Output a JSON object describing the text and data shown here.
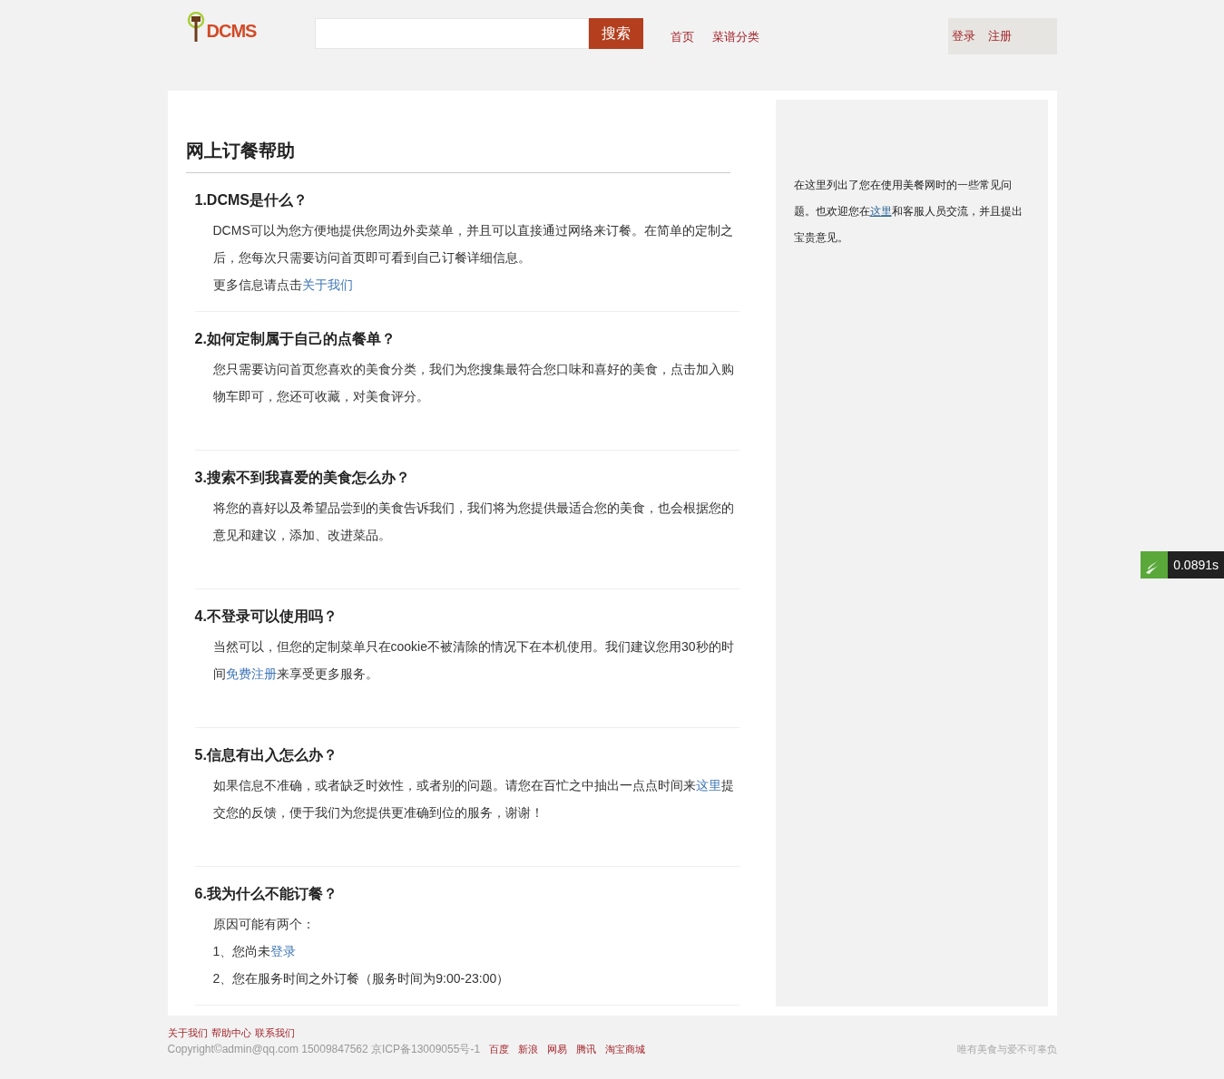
{
  "header": {
    "logo": "DCMS",
    "search": {
      "button": "搜索"
    },
    "nav": [
      "首页",
      "菜谱分类"
    ],
    "account": [
      "登录",
      "注册"
    ]
  },
  "page_title": "网上订餐帮助",
  "faq": [
    {
      "title": "1.DCMS是什么？",
      "paragraphs": [
        [
          {
            "text": "DCMS可以为您方便地提供您周边外卖菜单，并且可以直接通过网络来订餐。在简单的定制之后，您每次只需要访问首页即可看到自己订餐详细信息。"
          }
        ],
        [
          {
            "text": "更多信息请点击"
          },
          {
            "link": "关于我们"
          }
        ]
      ]
    },
    {
      "title": "2.如何定制属于自己的点餐单？",
      "paragraphs": [
        [
          {
            "text": "您只需要访问首页您喜欢的美食分类，我们为您搜集最符合您口味和喜好的美食，点击加入购物车即可，您还可收藏，对美食评分。"
          }
        ]
      ]
    },
    {
      "title": "3.搜索不到我喜爱的美食怎么办？",
      "paragraphs": [
        [
          {
            "text": "将您的喜好以及希望品尝到的美食告诉我们，我们将为您提供最适合您的美食，也会根据您的意见和建议，添加、改进菜品。"
          }
        ]
      ]
    },
    {
      "title": "4.不登录可以使用吗？",
      "paragraphs": [
        [
          {
            "text": "当然可以，但您的定制菜单只在cookie不被清除的情况下在本机使用。我们建议您用30秒的时间"
          },
          {
            "link": "免费注册"
          },
          {
            "text": "来享受更多服务。"
          }
        ]
      ]
    },
    {
      "title": "5.信息有出入怎么办？",
      "paragraphs": [
        [
          {
            "text": "如果信息不准确，或者缺乏时效性，或者别的问题。请您在百忙之中抽出一点点时间来"
          },
          {
            "link": "这里"
          },
          {
            "text": "提交您的反馈，便于我们为您提供更准确到位的服务，谢谢！"
          }
        ]
      ]
    },
    {
      "title": "6.我为什么不能订餐？",
      "paragraphs": [
        [
          {
            "text": "原因可能有两个："
          }
        ],
        [
          {
            "text": "1、您尚未"
          },
          {
            "link": "登录"
          }
        ],
        [
          {
            "text": "2、您在服务时间之外订餐（服务时间为9:00-23:00）"
          }
        ]
      ]
    }
  ],
  "sidebar": [
    {
      "text": "在这里列出了您在使用美餐网时的一些常见问题。也欢迎您在"
    },
    {
      "link": "这里"
    },
    {
      "text": "和客服人员交流，并且提出宝贵意见。"
    }
  ],
  "timer": "0.0891s",
  "footer": {
    "links": [
      "关于我们",
      "帮助中心",
      "联系我们"
    ],
    "copyright": "Copyright©admin@qq.com 15009847562 京ICP备13009055号-1",
    "partners": [
      "百度",
      "新浪",
      "网易",
      "腾讯",
      "淘宝商城"
    ],
    "slogan": "唯有美食与爱不可辜负"
  }
}
